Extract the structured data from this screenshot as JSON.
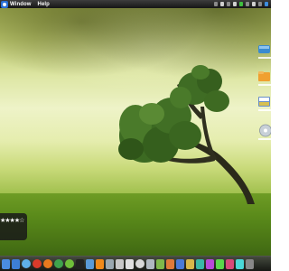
{
  "menubar": {
    "items": [
      {
        "label": "Window"
      },
      {
        "label": "Help"
      }
    ]
  },
  "rating_widget": {
    "stars": "★★★★☆"
  },
  "desktop_icons": [
    {
      "icon": "drive-icon",
      "color": "#3a8bd0"
    },
    {
      "icon": "folder-icon",
      "color": "#f0a030"
    },
    {
      "icon": "disk-icon",
      "color": "#7aa8d8"
    },
    {
      "icon": "cd-icon",
      "color": "#c8d0d8"
    }
  ],
  "dock": {
    "items": [
      {
        "icon": "finder-icon",
        "color": "#4a8ce0"
      },
      {
        "icon": "mail-icon",
        "color": "#3d7fd6"
      },
      {
        "icon": "safari-icon",
        "color": "#5fb0e8"
      },
      {
        "icon": "opera-icon",
        "color": "#d93a2a"
      },
      {
        "icon": "firefox-icon",
        "color": "#e87a1e"
      },
      {
        "icon": "chrome-icon",
        "color": "#3fa34d"
      },
      {
        "icon": "adium-icon",
        "color": "#6fbf3a"
      },
      {
        "icon": "terminal-icon",
        "color": "#222222"
      },
      {
        "icon": "itunes-icon",
        "color": "#5a9ad8"
      },
      {
        "icon": "vlc-icon",
        "color": "#f08a1a"
      },
      {
        "icon": "preview-icon",
        "color": "#9aa8b0"
      },
      {
        "icon": "photos-icon",
        "color": "#c8c8c8"
      },
      {
        "icon": "calendar-icon",
        "color": "#e0e0e0"
      },
      {
        "icon": "clock-icon",
        "color": "#d8d8d8"
      },
      {
        "icon": "trash-icon",
        "color": "#b0b8c0"
      },
      {
        "icon": "app-icon",
        "color": "#7fb84a"
      },
      {
        "icon": "app-icon",
        "color": "#e07a3a"
      },
      {
        "icon": "app-icon",
        "color": "#4a7ad8"
      },
      {
        "icon": "app-icon",
        "color": "#d8b84a"
      },
      {
        "icon": "app-icon",
        "color": "#3ab8a8"
      },
      {
        "icon": "app-icon",
        "color": "#b84ad8"
      },
      {
        "icon": "app-icon",
        "color": "#5ad84a"
      },
      {
        "icon": "app-icon",
        "color": "#d84a7a"
      },
      {
        "icon": "app-icon",
        "color": "#4ad8d8"
      },
      {
        "icon": "app-icon",
        "color": "#888888"
      }
    ]
  }
}
